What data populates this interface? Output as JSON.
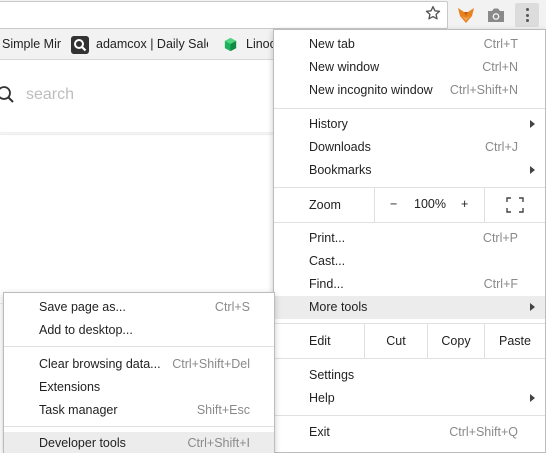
{
  "bookmarks": [
    {
      "label": "Simple Mir"
    },
    {
      "label": "adamcox | Daily Sales"
    },
    {
      "label": "Linoc"
    }
  ],
  "search": {
    "placeholder": "search",
    "value": ""
  },
  "menu": {
    "new_tab": {
      "label": "New tab",
      "shortcut": "Ctrl+T"
    },
    "new_window": {
      "label": "New window",
      "shortcut": "Ctrl+N"
    },
    "new_incognito": {
      "label": "New incognito window",
      "shortcut": "Ctrl+Shift+N"
    },
    "history": {
      "label": "History"
    },
    "downloads": {
      "label": "Downloads",
      "shortcut": "Ctrl+J"
    },
    "bookmarks": {
      "label": "Bookmarks"
    },
    "zoom": {
      "label": "Zoom",
      "minus": "−",
      "value": "100%",
      "plus": "+"
    },
    "print": {
      "label": "Print...",
      "shortcut": "Ctrl+P"
    },
    "cast": {
      "label": "Cast..."
    },
    "find": {
      "label": "Find...",
      "shortcut": "Ctrl+F"
    },
    "more_tools": {
      "label": "More tools"
    },
    "edit": {
      "label": "Edit",
      "cut": "Cut",
      "copy": "Copy",
      "paste": "Paste"
    },
    "settings": {
      "label": "Settings"
    },
    "help": {
      "label": "Help"
    },
    "exit": {
      "label": "Exit",
      "shortcut": "Ctrl+Shift+Q"
    }
  },
  "more_tools": {
    "save_page": {
      "label": "Save page as...",
      "shortcut": "Ctrl+S"
    },
    "add_to_desktop": {
      "label": "Add to desktop..."
    },
    "clear_browsing": {
      "label": "Clear browsing data...",
      "shortcut": "Ctrl+Shift+Del"
    },
    "extensions": {
      "label": "Extensions"
    },
    "task_manager": {
      "label": "Task manager",
      "shortcut": "Shift+Esc"
    },
    "developer_tools": {
      "label": "Developer tools",
      "shortcut": "Ctrl+Shift+I"
    }
  },
  "icons": {
    "star": "star-icon",
    "fox": "fox-extension-icon",
    "camera": "camera-icon",
    "menu": "three-dots-menu-icon",
    "search": "search-icon",
    "fullscreen": "fullscreen-icon"
  },
  "colors": {
    "menu_highlight": "#ececec",
    "toolbar": "#f2f2f2",
    "fox_orange": "#e8821e",
    "linode_green": "#1cb35c"
  }
}
